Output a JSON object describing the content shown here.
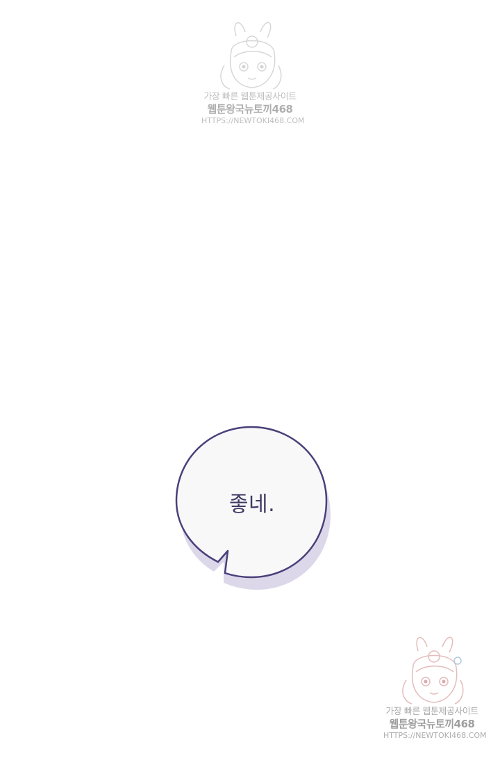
{
  "watermark": {
    "line1": "가장 빠른 웹툰제공사이트",
    "line2": "웹툰왕국뉴토끼468",
    "line3": "HTTPS://NEWTOKI468.COM"
  },
  "speech_bubble": {
    "text": "좋네."
  },
  "colors": {
    "background": "#ffffff",
    "bubble_fill": "#f8f8f9",
    "bubble_outline": "#4a3f7a",
    "bubble_shadow": "#dcd8ea",
    "text": "#3f3a63"
  }
}
